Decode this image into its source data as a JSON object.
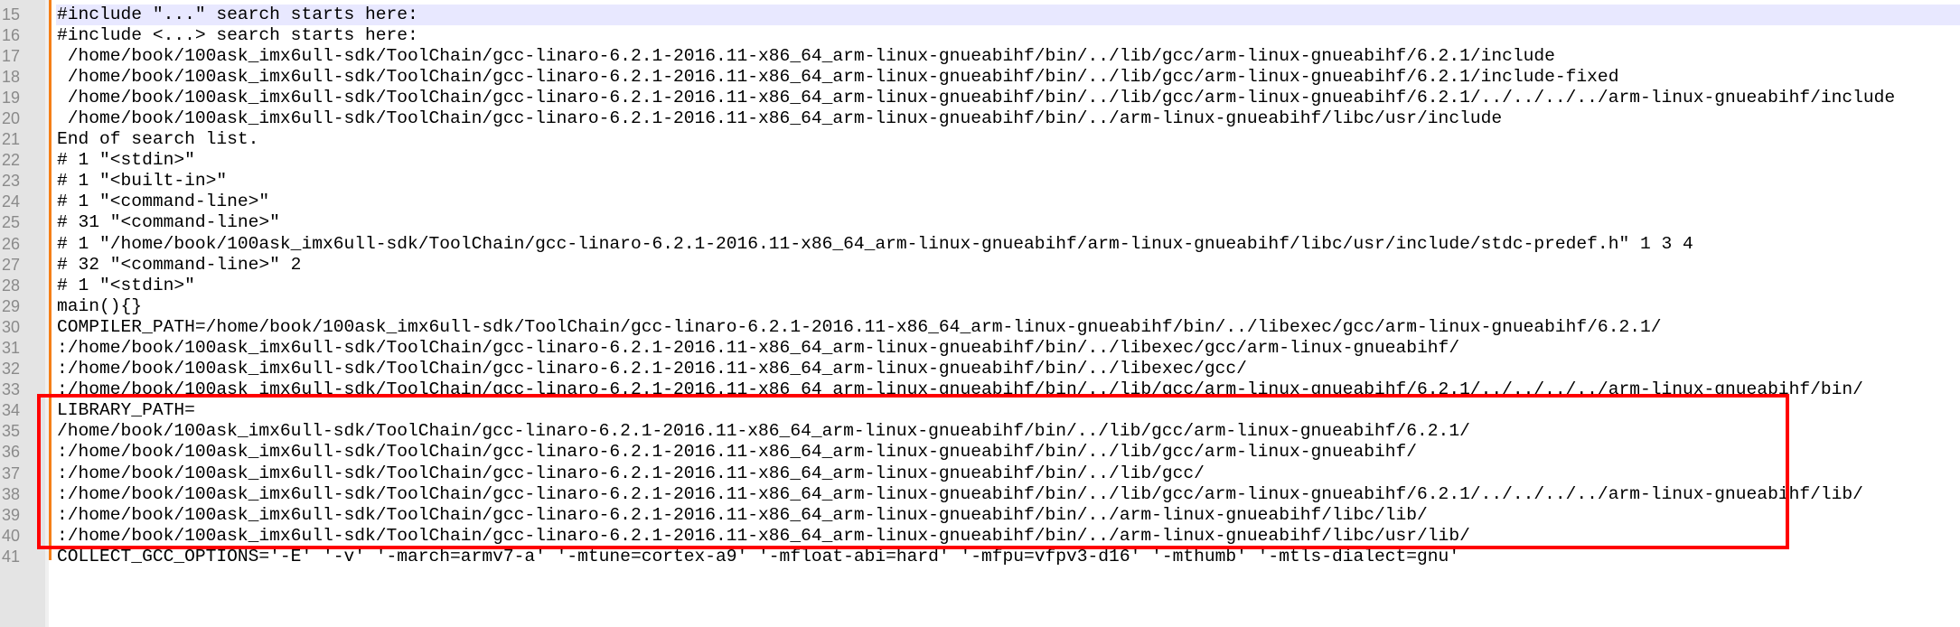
{
  "editor": {
    "current_line": 15,
    "lines": [
      {
        "num": "15",
        "text": "#include \"...\" search starts here:"
      },
      {
        "num": "16",
        "text": "#include <...> search starts here:"
      },
      {
        "num": "17",
        "text": " /home/book/100ask_imx6ull-sdk/ToolChain/gcc-linaro-6.2.1-2016.11-x86_64_arm-linux-gnueabihf/bin/../lib/gcc/arm-linux-gnueabihf/6.2.1/include"
      },
      {
        "num": "18",
        "text": " /home/book/100ask_imx6ull-sdk/ToolChain/gcc-linaro-6.2.1-2016.11-x86_64_arm-linux-gnueabihf/bin/../lib/gcc/arm-linux-gnueabihf/6.2.1/include-fixed"
      },
      {
        "num": "19",
        "text": " /home/book/100ask_imx6ull-sdk/ToolChain/gcc-linaro-6.2.1-2016.11-x86_64_arm-linux-gnueabihf/bin/../lib/gcc/arm-linux-gnueabihf/6.2.1/../../../../arm-linux-gnueabihf/include"
      },
      {
        "num": "20",
        "text": " /home/book/100ask_imx6ull-sdk/ToolChain/gcc-linaro-6.2.1-2016.11-x86_64_arm-linux-gnueabihf/bin/../arm-linux-gnueabihf/libc/usr/include"
      },
      {
        "num": "21",
        "text": "End of search list."
      },
      {
        "num": "22",
        "text": "# 1 \"<stdin>\""
      },
      {
        "num": "23",
        "text": "# 1 \"<built-in>\""
      },
      {
        "num": "24",
        "text": "# 1 \"<command-line>\""
      },
      {
        "num": "25",
        "text": "# 31 \"<command-line>\""
      },
      {
        "num": "26",
        "text": "# 1 \"/home/book/100ask_imx6ull-sdk/ToolChain/gcc-linaro-6.2.1-2016.11-x86_64_arm-linux-gnueabihf/arm-linux-gnueabihf/libc/usr/include/stdc-predef.h\" 1 3 4"
      },
      {
        "num": "27",
        "text": "# 32 \"<command-line>\" 2"
      },
      {
        "num": "28",
        "text": "# 1 \"<stdin>\""
      },
      {
        "num": "29",
        "text": "main(){}"
      },
      {
        "num": "30",
        "text": "COMPILER_PATH=/home/book/100ask_imx6ull-sdk/ToolChain/gcc-linaro-6.2.1-2016.11-x86_64_arm-linux-gnueabihf/bin/../libexec/gcc/arm-linux-gnueabihf/6.2.1/"
      },
      {
        "num": "31",
        "text": ":/home/book/100ask_imx6ull-sdk/ToolChain/gcc-linaro-6.2.1-2016.11-x86_64_arm-linux-gnueabihf/bin/../libexec/gcc/arm-linux-gnueabihf/"
      },
      {
        "num": "32",
        "text": ":/home/book/100ask_imx6ull-sdk/ToolChain/gcc-linaro-6.2.1-2016.11-x86_64_arm-linux-gnueabihf/bin/../libexec/gcc/"
      },
      {
        "num": "33",
        "text": ":/home/book/100ask_imx6ull-sdk/ToolChain/gcc-linaro-6.2.1-2016.11-x86_64_arm-linux-gnueabihf/bin/../lib/gcc/arm-linux-gnueabihf/6.2.1/../../../../arm-linux-gnueabihf/bin/"
      },
      {
        "num": "34",
        "text": "LIBRARY_PATH="
      },
      {
        "num": "35",
        "text": "/home/book/100ask_imx6ull-sdk/ToolChain/gcc-linaro-6.2.1-2016.11-x86_64_arm-linux-gnueabihf/bin/../lib/gcc/arm-linux-gnueabihf/6.2.1/"
      },
      {
        "num": "36",
        "text": ":/home/book/100ask_imx6ull-sdk/ToolChain/gcc-linaro-6.2.1-2016.11-x86_64_arm-linux-gnueabihf/bin/../lib/gcc/arm-linux-gnueabihf/"
      },
      {
        "num": "37",
        "text": ":/home/book/100ask_imx6ull-sdk/ToolChain/gcc-linaro-6.2.1-2016.11-x86_64_arm-linux-gnueabihf/bin/../lib/gcc/"
      },
      {
        "num": "38",
        "text": ":/home/book/100ask_imx6ull-sdk/ToolChain/gcc-linaro-6.2.1-2016.11-x86_64_arm-linux-gnueabihf/bin/../lib/gcc/arm-linux-gnueabihf/6.2.1/../../../../arm-linux-gnueabihf/lib/"
      },
      {
        "num": "39",
        "text": ":/home/book/100ask_imx6ull-sdk/ToolChain/gcc-linaro-6.2.1-2016.11-x86_64_arm-linux-gnueabihf/bin/../arm-linux-gnueabihf/libc/lib/"
      },
      {
        "num": "40",
        "text": ":/home/book/100ask_imx6ull-sdk/ToolChain/gcc-linaro-6.2.1-2016.11-x86_64_arm-linux-gnueabihf/bin/../arm-linux-gnueabihf/libc/usr/lib/"
      },
      {
        "num": "41",
        "text": "COLLECT_GCC_OPTIONS='-E' '-v' '-march=armv7-a' '-mtune=cortex-a9' '-mfloat-abi=hard' '-mfpu=vfpv3-d16' '-mthumb' '-mtls-dialect=gnu'"
      }
    ]
  },
  "colors": {
    "annotation_box": "#ff0000",
    "current_line_bg": "#e8e8ff",
    "change_bar": "#f57f17"
  }
}
